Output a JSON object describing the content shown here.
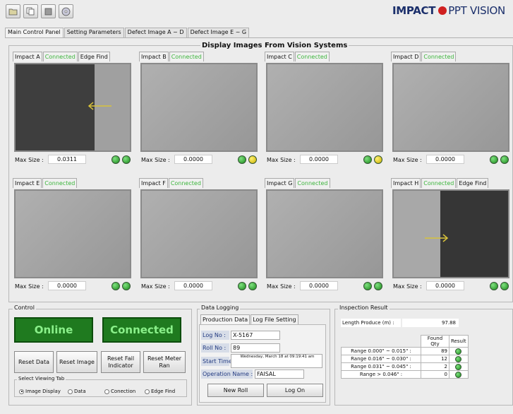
{
  "toolbar": {
    "icons": [
      "folder-icon",
      "copy-icon",
      "stop-icon",
      "cd-icon"
    ]
  },
  "brand": {
    "left": "IMPACT",
    "right": "PPT VISION",
    "color": "#1b2f6b",
    "accent": "#d02020"
  },
  "main_tabs": [
    {
      "label": "Main Control Panel",
      "active": true
    },
    {
      "label": "Setting Parameters",
      "active": false
    },
    {
      "label": "Defect Image A ~ D",
      "active": false
    },
    {
      "label": "Defect Image E ~ G",
      "active": false
    }
  ],
  "display": {
    "title": "Display Images From Vision Systems",
    "max_size_label": "Max Size :",
    "panels": [
      {
        "name": "Impact A",
        "status": "Connected",
        "extra": "Edge Find",
        "value": "0.0311",
        "dots": [
          "green",
          "green"
        ],
        "image": "edge-left"
      },
      {
        "name": "Impact B",
        "status": "Connected",
        "extra": "",
        "value": "0.0000",
        "dots": [
          "green",
          "yellow"
        ],
        "image": "plain"
      },
      {
        "name": "Impact C",
        "status": "Connected",
        "extra": "",
        "value": "0.0000",
        "dots": [
          "green",
          "yellow"
        ],
        "image": "plain"
      },
      {
        "name": "Impact D",
        "status": "Connected",
        "extra": "",
        "value": "0.0000",
        "dots": [
          "green",
          "green"
        ],
        "image": "plain"
      },
      {
        "name": "Impact E",
        "status": "Connected",
        "extra": "",
        "value": "0.0000",
        "dots": [
          "green",
          "green"
        ],
        "image": "plain"
      },
      {
        "name": "Impact F",
        "status": "Connected",
        "extra": "",
        "value": "0.0000",
        "dots": [
          "green",
          "green"
        ],
        "image": "plain"
      },
      {
        "name": "Impact G",
        "status": "Connected",
        "extra": "",
        "value": "0.0000",
        "dots": [
          "green",
          "green"
        ],
        "image": "plain"
      },
      {
        "name": "Impact H",
        "status": "Connected",
        "extra": "Edge Find",
        "value": "0.0000",
        "dots": [
          "green",
          "green"
        ],
        "image": "edge-right"
      }
    ]
  },
  "control": {
    "title": "Control",
    "online": "Online",
    "connected": "Connected",
    "reset_data": "Reset Data",
    "reset_image": "Reset Image",
    "reset_fail": "Reset Fail Indicator",
    "reset_meter": "Reset Meter Ran",
    "viewing_title": "Select Viewing Tab",
    "radios": [
      {
        "label": "Image Display",
        "checked": true
      },
      {
        "label": "Data",
        "checked": false
      },
      {
        "label": "Conection",
        "checked": false
      },
      {
        "label": "Edge Find",
        "checked": false
      }
    ]
  },
  "logging": {
    "title": "Data Logging",
    "tabs": [
      "Production Data",
      "Log File Setting"
    ],
    "log_no_label": "Log No :",
    "log_no": "X-5167",
    "roll_no_label": "Roll No :",
    "roll_no": "89",
    "start_time_label": "Start Time :",
    "start_time": "Wednesday, March 18 at 09:19:41 am",
    "operator_label": "Operation Name :",
    "operator": "FAISAL",
    "new_roll": "New Roll",
    "log_on": "Log On"
  },
  "inspection": {
    "title": "Inspection Result",
    "length_label": "Length Produce (m) :",
    "length_value": "97.88",
    "headers": [
      "Found Qty",
      "Result"
    ],
    "rows": [
      {
        "range": "Range 0.000\" ~ 0.015\" :",
        "qty": "89"
      },
      {
        "range": "Range 0.016\" ~ 0.030\" :",
        "qty": "12"
      },
      {
        "range": "Range 0.031\" ~ 0.045\" :",
        "qty": "2"
      },
      {
        "range": "Range > 0.046\" :",
        "qty": "0"
      }
    ]
  }
}
